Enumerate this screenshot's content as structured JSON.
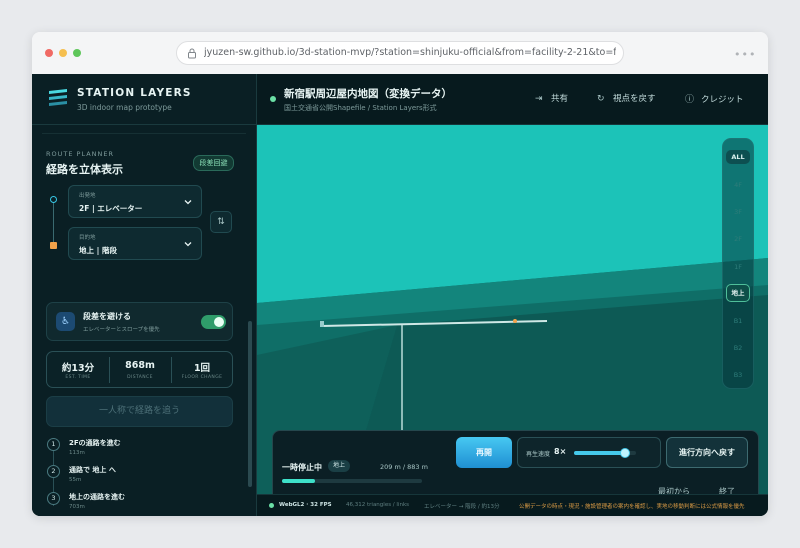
{
  "browser": {
    "url": "jyuzen-sw.github.io/3d-station-mvp/?station=shinjuku-official&from=facility-2-21&to=faci…"
  },
  "brand": {
    "title": "STATION LAYERS",
    "subtitle": "3D indoor map prototype"
  },
  "header": {
    "title": "新宿駅周辺屋内地図（変換データ）",
    "subtitle": "国土交通省公開Shapefile / Station Layers形式",
    "share_label": "共有",
    "reset_view_label": "視点を戻す",
    "credit_label": "クレジット"
  },
  "route_planner": {
    "section_label": "ROUTE PLANNER",
    "title": "経路を立体表示",
    "badge": "段差回避",
    "origin_label": "出発地",
    "origin_value": "2F | エレベーター",
    "destination_label": "目的地",
    "destination_value": "地上 | 階段",
    "avoid_steps": {
      "title": "段差を避ける",
      "subtitle": "エレベーターとスロープを優先",
      "enabled": true
    },
    "stats": [
      {
        "value": "約13分",
        "label": "EST. TIME"
      },
      {
        "value": "868m",
        "label": "DISTANCE"
      },
      {
        "value": "1回",
        "label": "FLOOR CHANGE"
      }
    ],
    "cta_label": "一人称で経路を追う",
    "steps": [
      {
        "num": "1",
        "title": "2Fの通路を進む",
        "distance": "113m"
      },
      {
        "num": "2",
        "title": "通路で 地上 へ",
        "distance": "55m"
      },
      {
        "num": "3",
        "title": "地上の通路を進む",
        "distance": "703m"
      }
    ]
  },
  "floors": {
    "all_label": "ALL",
    "items": [
      "4F",
      "3F",
      "2F",
      "1F",
      "地上",
      "B1",
      "B2",
      "B3"
    ],
    "active": "地上"
  },
  "playback": {
    "state_label": "一時停止中",
    "floor_badge": "地上",
    "distance_text": "209 m / 883 m",
    "progress": 0.237,
    "resume_label": "再開",
    "speed_label": "再生速度",
    "speed_value": "8×",
    "speed_level": 0.82,
    "back_label": "進行方向へ戻す",
    "from_start_label": "最初から",
    "end_label": "終了"
  },
  "status": {
    "fps": "WebGL2 · 32 FPS",
    "geometry": "46,312 triangles / links",
    "route_info": "エレベーター → 階段 / 約13分",
    "notice": "公開データの時点・現況・施設管理者の案内を確認し、実地の移動判断には公式情報を優先"
  },
  "colors": {
    "map_teal": "#1cc3b8",
    "accent_cyan": "#45c9ea",
    "accent_green": "#6be0a6",
    "warning_orange": "#f2a24a"
  },
  "icons": [
    "lock-icon",
    "brand-stack-icon",
    "share-icon",
    "reset-view-icon",
    "info-icon",
    "chevron-down-icon",
    "swap-icon",
    "wheelchair-icon"
  ]
}
